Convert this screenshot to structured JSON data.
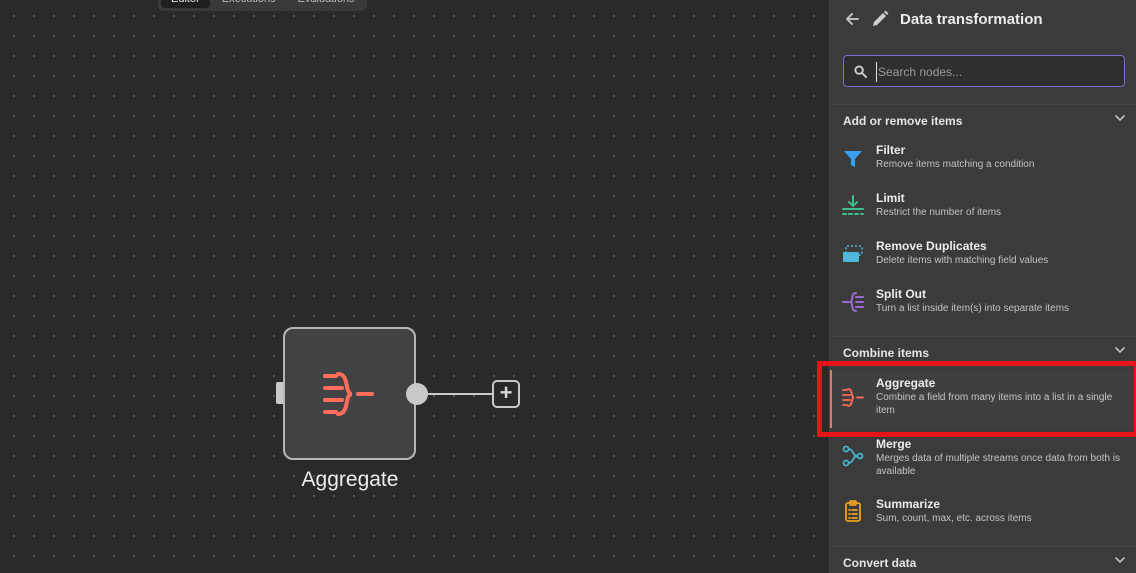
{
  "canvas": {
    "tabs": [
      {
        "label": "Editor",
        "active": true
      },
      {
        "label": "Executions",
        "active": false
      },
      {
        "label": "Evaluations",
        "active": false
      }
    ],
    "node": {
      "label": "Aggregate",
      "icon": "aggregate-icon",
      "color": "#ff6d5a"
    },
    "add_button_label": "+"
  },
  "panel": {
    "title": "Data transformation",
    "search": {
      "placeholder": "Search nodes...",
      "value": ""
    },
    "sections": [
      {
        "title": "Add or remove items",
        "items": [
          {
            "title": "Filter",
            "desc": "Remove items matching a condition",
            "icon": "filter-icon",
            "color": "#3aa0f0"
          },
          {
            "title": "Limit",
            "desc": "Restrict the number of items",
            "icon": "limit-icon",
            "color": "#3cc08a"
          },
          {
            "title": "Remove Duplicates",
            "desc": "Delete items with matching field values",
            "icon": "remove-duplicates-icon",
            "color": "#4fb8d8"
          },
          {
            "title": "Split Out",
            "desc": "Turn a list inside item(s) into separate items",
            "icon": "split-out-icon",
            "color": "#9a6ad6"
          }
        ]
      },
      {
        "title": "Combine items",
        "items": [
          {
            "title": "Aggregate",
            "desc": "Combine a field from many items into a list in a single item",
            "icon": "aggregate-icon",
            "color": "#ff6d5a"
          },
          {
            "title": "Merge",
            "desc": "Merges data of multiple streams once data from both is available",
            "icon": "merge-icon",
            "color": "#45b5d0"
          },
          {
            "title": "Summarize",
            "desc": "Sum, count, max, etc. across items",
            "icon": "summarize-icon",
            "color": "#f0a020"
          }
        ]
      },
      {
        "title": "Convert data",
        "items": []
      }
    ]
  },
  "colors": {
    "highlight": "#e8141c",
    "search_border": "#7b6fd6"
  }
}
